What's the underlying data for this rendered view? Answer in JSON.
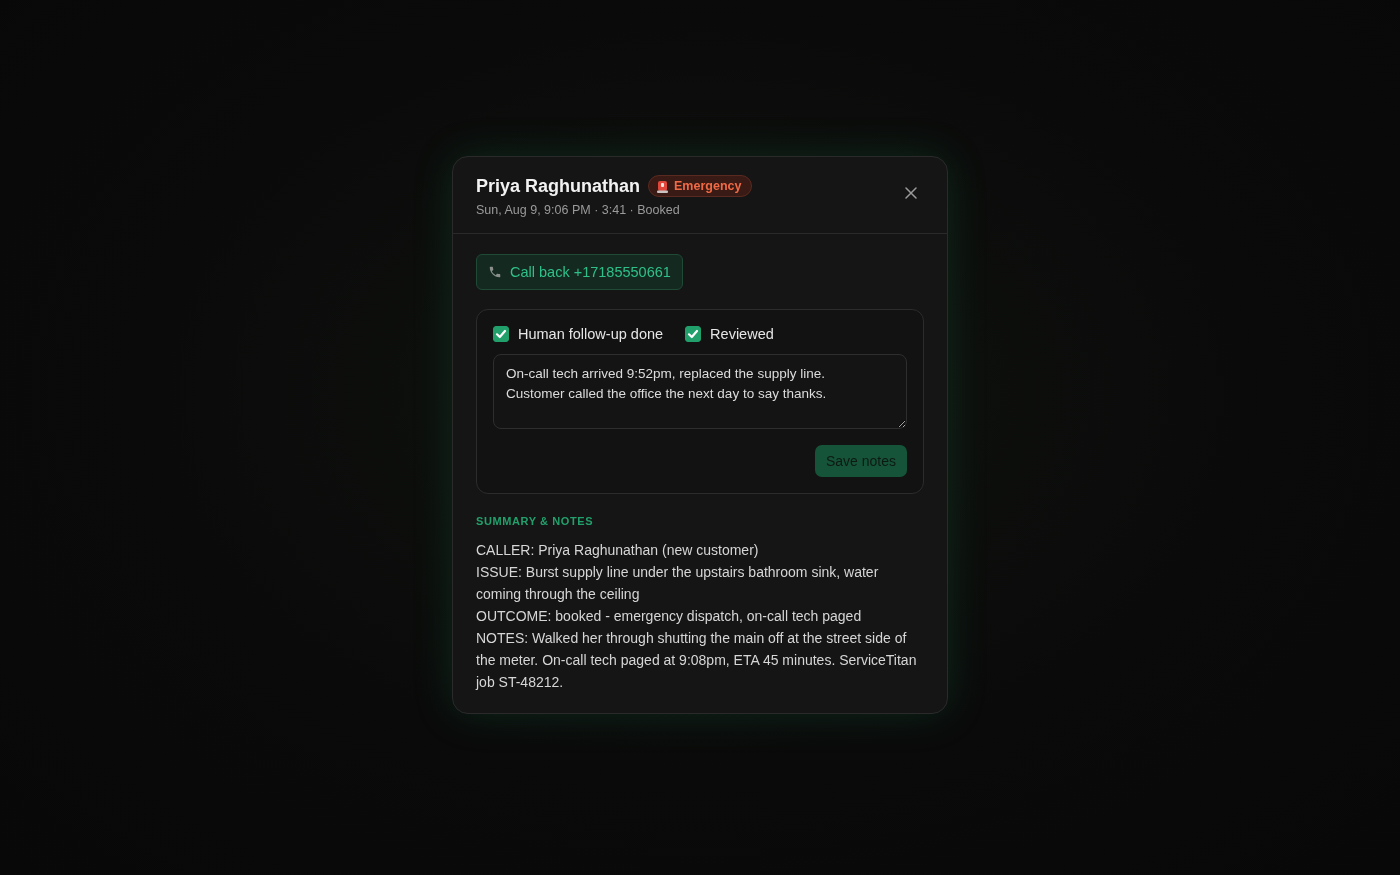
{
  "dialog": {
    "title": "Priya Raghunathan",
    "badge": "Emergency",
    "meta": "Sun, Aug 9, 9:06 PM · 3:41 · Booked",
    "call_button": "Call back +17185550661",
    "checkboxes": [
      {
        "label": "Human follow-up done",
        "checked": true
      },
      {
        "label": "Reviewed",
        "checked": true
      }
    ],
    "notes_value": "On-call tech arrived 9:52pm, replaced the supply line.\nCustomer called the office the next day to say thanks.",
    "save_button": "Save notes",
    "section_heading": "SUMMARY & NOTES",
    "summary": [
      "CALLER: Priya Raghunathan (new customer)",
      "ISSUE: Burst supply line under the upstairs bathroom sink, water coming through the ceiling",
      "OUTCOME: booked - emergency dispatch, on-call tech paged",
      "NOTES: Walked her through shutting the main off at the street side of the meter. On-call tech paged at 9:08pm, ETA 45 minutes. ServiceTitan job ST-48212."
    ]
  }
}
